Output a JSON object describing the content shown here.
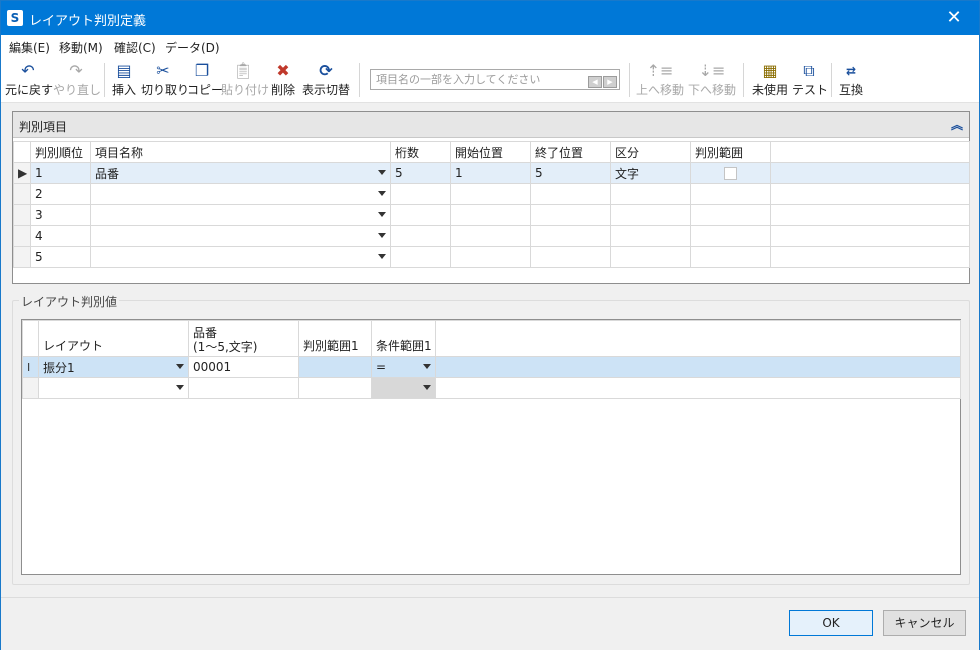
{
  "window": {
    "title": "レイアウト判別定義",
    "app_icon": "S"
  },
  "menu": [
    {
      "label": "編集(E)"
    },
    {
      "label": "移動(M)"
    },
    {
      "label": "確認(C)"
    },
    {
      "label": "データ(D)"
    }
  ],
  "toolbar": {
    "undo": "元に戻す",
    "redo": "やり直し",
    "insert": "挿入",
    "cut": "切り取り",
    "copy": "コピー",
    "paste": "貼り付け",
    "delete": "削除",
    "toggle_display": "表示切替",
    "search_placeholder": "項目名の一部を入力してください",
    "move_up": "上へ移動",
    "move_down": "下へ移動",
    "unused": "未使用",
    "test": "テスト",
    "swap": "互換"
  },
  "panel_items": {
    "title": "判別項目",
    "columns": [
      "判別順位",
      "項目名称",
      "桁数",
      "開始位置",
      "終了位置",
      "区分",
      "判別範囲"
    ],
    "rows": [
      {
        "order": "1",
        "name": "品番",
        "digits": "5",
        "start": "1",
        "end": "5",
        "type": "文字"
      },
      {
        "order": "2",
        "name": "",
        "digits": "",
        "start": "",
        "end": "",
        "type": ""
      },
      {
        "order": "3",
        "name": "",
        "digits": "",
        "start": "",
        "end": "",
        "type": ""
      },
      {
        "order": "4",
        "name": "",
        "digits": "",
        "start": "",
        "end": "",
        "type": ""
      },
      {
        "order": "5",
        "name": "",
        "digits": "",
        "start": "",
        "end": "",
        "type": ""
      }
    ]
  },
  "panel_values": {
    "title": "レイアウト判別値",
    "columns": {
      "layout": "レイアウト",
      "item_line1": "品番",
      "item_line2": "(1～5,文字)",
      "range": "判別範囲1",
      "condition": "条件範囲1"
    },
    "rows": [
      {
        "layout": "振分1",
        "item": "00001",
        "range": "",
        "condition": "="
      },
      {
        "layout": "",
        "item": "",
        "range": "",
        "condition": ""
      }
    ]
  },
  "buttons": {
    "ok": "OK",
    "cancel": "キャンセル"
  },
  "colors": {
    "titlebar": "#0078d7",
    "selection": "#cde3f6",
    "accent_border": "#0078d7"
  }
}
